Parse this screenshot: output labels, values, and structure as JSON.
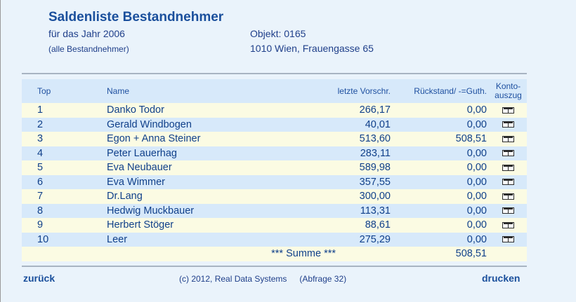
{
  "header": {
    "title": "Saldenliste Bestandnehmer",
    "year_line": "für das Jahr 2006",
    "scope_line": "(alle Bestandnehmer)",
    "object_line": "Objekt: 0165",
    "address_line": "1010 Wien, Frauengasse 65"
  },
  "table": {
    "columns": {
      "top": "Top",
      "name": "Name",
      "vorschreibung": "letzte Vorschr.",
      "rueckstand": "Rückstand/ -=Guth.",
      "konto_line1": "Konto-",
      "konto_line2": "auszug"
    },
    "rows": [
      {
        "top": "1",
        "name": "Danko Todor",
        "vorschreibung": "266,17",
        "rueckstand": "0,00"
      },
      {
        "top": "2",
        "name": "Gerald Windbogen",
        "vorschreibung": "40,01",
        "rueckstand": "0,00"
      },
      {
        "top": "3",
        "name": "Egon + Anna Steiner",
        "vorschreibung": "513,60",
        "rueckstand": "508,51"
      },
      {
        "top": "4",
        "name": "Peter Lauerhag",
        "vorschreibung": "283,11",
        "rueckstand": "0,00"
      },
      {
        "top": "5",
        "name": "Eva Neubauer",
        "vorschreibung": "589,98",
        "rueckstand": "0,00"
      },
      {
        "top": "6",
        "name": "Eva Wimmer",
        "vorschreibung": "357,55",
        "rueckstand": "0,00"
      },
      {
        "top": "7",
        "name": "Dr.Lang",
        "vorschreibung": "300,00",
        "rueckstand": "0,00"
      },
      {
        "top": "8",
        "name": "Hedwig Muckbauer",
        "vorschreibung": "113,31",
        "rueckstand": "0,00"
      },
      {
        "top": "9",
        "name": "Herbert Stöger",
        "vorschreibung": "88,61",
        "rueckstand": "0,00"
      },
      {
        "top": "10",
        "name": "Leer",
        "vorschreibung": "275,29",
        "rueckstand": "0,00"
      }
    ],
    "sum_label": "*** Summe ***",
    "sum_value": "508,51",
    "konto_icon": "document-table-icon"
  },
  "footer": {
    "back_label": "zurück",
    "copyright": "(c) 2012, Real Data Systems",
    "query": "(Abfrage 32)",
    "print_label": "drucken"
  },
  "colors": {
    "background": "#eaf3fb",
    "accent": "#1a4f9c",
    "row_light": "#fbfbe3",
    "row_blue": "#d7e9fa"
  }
}
